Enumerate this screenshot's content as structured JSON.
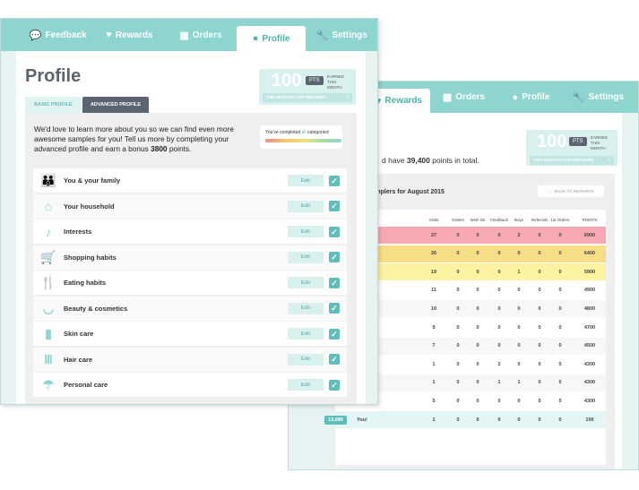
{
  "back": {
    "tabs": [
      {
        "label": "Rewards",
        "icon": "heart-icon",
        "active": true
      },
      {
        "label": "Orders",
        "icon": "gift-icon"
      },
      {
        "label": "Profile",
        "icon": "user-icon"
      },
      {
        "label": "Settings",
        "icon": "wrench-icon"
      }
    ],
    "points_box": {
      "value": "100",
      "tag": "PTS",
      "earned": [
        "EARNED",
        "THIS",
        "MONTH"
      ],
      "dropdown": "THIS MONTH'S TOP PINCHERS"
    },
    "total_text_pre": "d have ",
    "total_points": "39,400",
    "total_text_post": " points in total.",
    "leaderboard_title": "per Samplers for August 2015",
    "back_button": "BACK TO REWARDS",
    "columns": [
      "Visits",
      "Orders",
      "Wish list",
      "Feedback",
      "Buys",
      "Referrals",
      "1st Orders",
      "POINTS"
    ],
    "rows": [
      [
        "27",
        "0",
        "0",
        "0",
        "2",
        "0",
        "0",
        "6900"
      ],
      [
        "26",
        "0",
        "0",
        "0",
        "0",
        "0",
        "0",
        "6400"
      ],
      [
        "19",
        "0",
        "0",
        "0",
        "1",
        "0",
        "0",
        "5900"
      ],
      [
        "11",
        "0",
        "0",
        "0",
        "0",
        "0",
        "0",
        "4900"
      ],
      [
        "10",
        "0",
        "0",
        "0",
        "0",
        "0",
        "0",
        "4800"
      ],
      [
        "9",
        "0",
        "0",
        "0",
        "0",
        "0",
        "0",
        "4700"
      ],
      [
        "7",
        "0",
        "0",
        "0",
        "0",
        "0",
        "0",
        "4500"
      ],
      [
        "1",
        "0",
        "0",
        "2",
        "0",
        "0",
        "0",
        "4300"
      ],
      [
        "1",
        "0",
        "0",
        "1",
        "1",
        "0",
        "0",
        "4300"
      ],
      [
        "5",
        "0",
        "0",
        "0",
        "0",
        "0",
        "0",
        "4300"
      ],
      [
        "1",
        "0",
        "0",
        "0",
        "0",
        "0",
        "0",
        "100"
      ]
    ],
    "row_colors": [
      "#f6a9b3",
      "#f7dd85",
      "#fbf3a0",
      "#ffffff",
      "#f7f7f7",
      "#ffffff",
      "#f7f7f7",
      "#ffffff",
      "#f7f7f7",
      "#ffffff",
      "#e3f5f4"
    ],
    "you_rank": "13,080",
    "you_label": "You!"
  },
  "front": {
    "tabs": [
      {
        "label": "Feedback",
        "icon": "speech-bubble-icon"
      },
      {
        "label": "Rewards",
        "icon": "heart-icon"
      },
      {
        "label": "Orders",
        "icon": "gift-icon"
      },
      {
        "label": "Profile",
        "icon": "user-icon",
        "active": true
      },
      {
        "label": "Settings",
        "icon": "wrench-icon"
      }
    ],
    "title": "Profile",
    "points_box": {
      "value": "100",
      "tag": "PTS",
      "earned": [
        "EARNED",
        "THIS",
        "MONTH"
      ],
      "dropdown": "THIS MONTH'S TOP PINCHERS"
    },
    "subtabs": [
      "BASIC PROFILE",
      "ADVANCED PROFILE"
    ],
    "intro_pre": "We'd love to learn more about you so we can find even more awesome samples for you! Tell us more by completing your advanced profile and earn a bonus ",
    "bonus": "3800",
    "intro_post": " points.",
    "completed_pre": "You've completed ",
    "completed_all": "all",
    "completed_post": " categories!",
    "edit_label": "Edit",
    "categories": [
      {
        "label": "You & your family",
        "icon": "family-icon",
        "glyph": "👪"
      },
      {
        "label": "Your household",
        "icon": "house-icon",
        "glyph": "⌂"
      },
      {
        "label": "Interests",
        "icon": "guitar-icon",
        "glyph": "♪"
      },
      {
        "label": "Shopping habits",
        "icon": "cart-icon",
        "glyph": "🛒"
      },
      {
        "label": "Eating habits",
        "icon": "fork-knife-icon",
        "glyph": "🍴"
      },
      {
        "label": "Beauty & cosmetics",
        "icon": "lips-icon",
        "glyph": "◡"
      },
      {
        "label": "Skin care",
        "icon": "lotion-icon",
        "glyph": "▮"
      },
      {
        "label": "Hair care",
        "icon": "comb-icon",
        "glyph": "Ⅲ"
      },
      {
        "label": "Personal care",
        "icon": "shower-icon",
        "glyph": "☂"
      }
    ]
  },
  "colors": {
    "teal": "#8ed4cf",
    "dark": "#5b6470",
    "accent": "#5fbfb8"
  }
}
